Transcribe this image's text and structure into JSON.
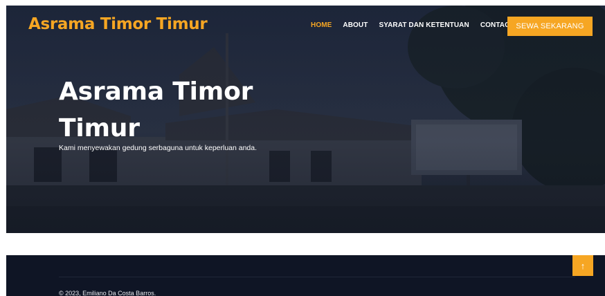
{
  "brand": {
    "name": "Asrama Timor Timur"
  },
  "nav": {
    "items": [
      {
        "label": "HOME",
        "active": true
      },
      {
        "label": "ABOUT",
        "active": false
      },
      {
        "label": "SYARAT DAN KETENTUAN",
        "active": false
      },
      {
        "label": "CONTACT",
        "active": false
      }
    ],
    "cta_label": "SEWA SEKARANG"
  },
  "hero": {
    "title": "Asrama Timor Timur",
    "subtitle": "Kami menyewakan gedung serbaguna untuk keperluan anda."
  },
  "footer": {
    "copyright": "© 2023, Emiliano Da Costa Barros."
  },
  "back_to_top": {
    "icon": "arrow-up-icon",
    "glyph": "↑"
  },
  "colors": {
    "accent": "#f6a623",
    "hero_overlay": "#1b2233",
    "footer_bg": "#0f1525"
  }
}
